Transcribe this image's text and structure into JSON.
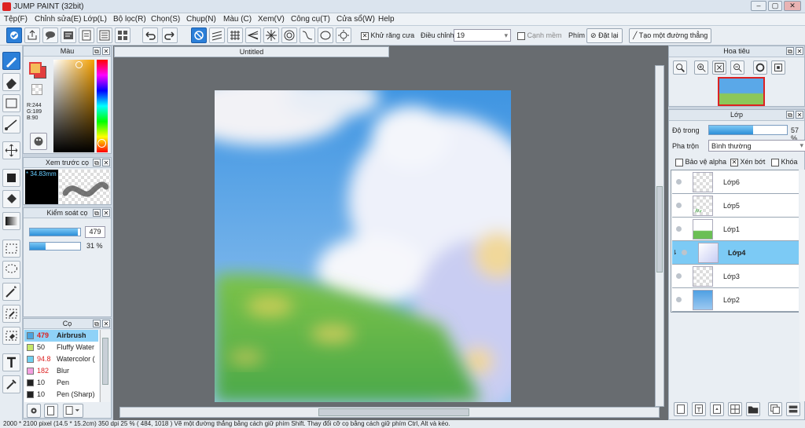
{
  "window": {
    "title": "JUMP PAINT (32bit)",
    "min": "–",
    "max": "▢",
    "close": "✕"
  },
  "menu": [
    "Tệp(F)",
    "Chỉnh sửa(E)",
    "Lớp(L)",
    "Bộ lọc(R)",
    "Chọn(S)",
    "Chụp(N)",
    "Màu (C)",
    "Xem(V)",
    "Công cụ(T)",
    "Cửa sổ(W)",
    "Help"
  ],
  "toolbar": {
    "antialias_label": "Khử răng cưa",
    "correction_label": "Điều chỉnh",
    "correction_value": "19",
    "canh_mem_label": "Cạnh mềm",
    "phim_label": "Phím",
    "reset_label": "Đặt lại",
    "straight_label": "Tạo một đường thẳng"
  },
  "color_panel": {
    "title": "Màu",
    "r": "R:244",
    "g": "G:189",
    "b": "B:90",
    "primary": "#f4bd5a",
    "secondary": "#e23e3e"
  },
  "preview_panel": {
    "title": "Xem trước cọ",
    "size": "34.83mm"
  },
  "brush_control": {
    "title": "Kiểm soát cọ",
    "size": "479",
    "opacity": "31 %",
    "size_fraction": 0.95,
    "opacity_fraction": 0.31
  },
  "brush_panel": {
    "title": "Cọ",
    "items": [
      {
        "size": "479",
        "name": "Airbrush",
        "color": "#4aa3df"
      },
      {
        "size": "50",
        "name": "Fluffy Water",
        "color": "#c6e86a"
      },
      {
        "size": "94.8",
        "name": "Watercolor (",
        "color": "#6fd0f0"
      },
      {
        "size": "182",
        "name": "Blur",
        "color": "#f4a0e0"
      },
      {
        "size": "10",
        "name": "Pen",
        "color": "#222222"
      },
      {
        "size": "10",
        "name": "Pen (Sharp)",
        "color": "#222222"
      }
    ]
  },
  "document": {
    "tab": "Untitled"
  },
  "navigator": {
    "title": "Hoa tiêu"
  },
  "layers": {
    "title": "Lớp",
    "opacity_label": "Độ trong",
    "opacity_value": "57 %",
    "opacity_fraction": 0.57,
    "blend_label": "Pha trộn",
    "blend_value": "Bình thường",
    "protect_alpha": "Bảo vệ alpha",
    "clipping": "Xén bớt",
    "lock": "Khóa",
    "items": [
      {
        "name": "Lớp6",
        "selected": false
      },
      {
        "name": "Lớp5",
        "selected": false
      },
      {
        "name": "Lớp1",
        "selected": false
      },
      {
        "name": "Lớp4",
        "selected": true
      },
      {
        "name": "Lớp3",
        "selected": false
      },
      {
        "name": "Lớp2",
        "selected": false
      }
    ]
  },
  "status": "2000 * 2100 pixel  (14.5 * 15.2cm)  350 dpi  25 %  ( 484, 1018 )  Vẽ một đường thẳng bằng cách giữ phím Shift. Thay đổi cỡ cọ bằng cách giữ phím Ctrl, Alt và kéo."
}
